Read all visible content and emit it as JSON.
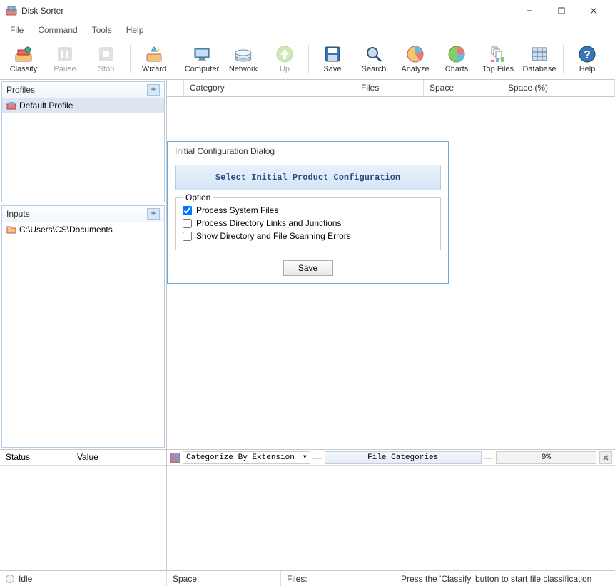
{
  "app": {
    "title": "Disk Sorter"
  },
  "menu": {
    "file": "File",
    "command": "Command",
    "tools": "Tools",
    "help": "Help"
  },
  "toolbar": {
    "classify": "Classify",
    "pause": "Pause",
    "stop": "Stop",
    "wizard": "Wizard",
    "computer": "Computer",
    "network": "Network",
    "up": "Up",
    "save": "Save",
    "search": "Search",
    "analyze": "Analyze",
    "charts": "Charts",
    "topfiles": "Top Files",
    "database": "Database",
    "help": "Help"
  },
  "profiles": {
    "title": "Profiles",
    "items": [
      {
        "label": "Default Profile"
      }
    ]
  },
  "inputs": {
    "title": "Inputs",
    "items": [
      {
        "label": "C:\\Users\\CS\\Documents"
      }
    ]
  },
  "category_header": {
    "category": "Category",
    "files": "Files",
    "space": "Space",
    "spacepct": "Space (%)"
  },
  "status_header": {
    "status": "Status",
    "value": "Value"
  },
  "filterbar": {
    "combo": "Categorize By Extension",
    "cat_btn": "File Categories",
    "progress": "0%"
  },
  "statusbar": {
    "state": "Idle",
    "space": "Space:",
    "files": "Files:",
    "hint": "Press the 'Classify' button to start file classification"
  },
  "dialog": {
    "title": "Initial Configuration Dialog",
    "banner": "Select Initial Product Configuration",
    "group_label": "Option",
    "opts": [
      {
        "label": "Process System Files",
        "checked": true
      },
      {
        "label": "Process Directory Links and Junctions",
        "checked": false
      },
      {
        "label": "Show Directory and File Scanning Errors",
        "checked": false
      }
    ],
    "save": "Save"
  }
}
